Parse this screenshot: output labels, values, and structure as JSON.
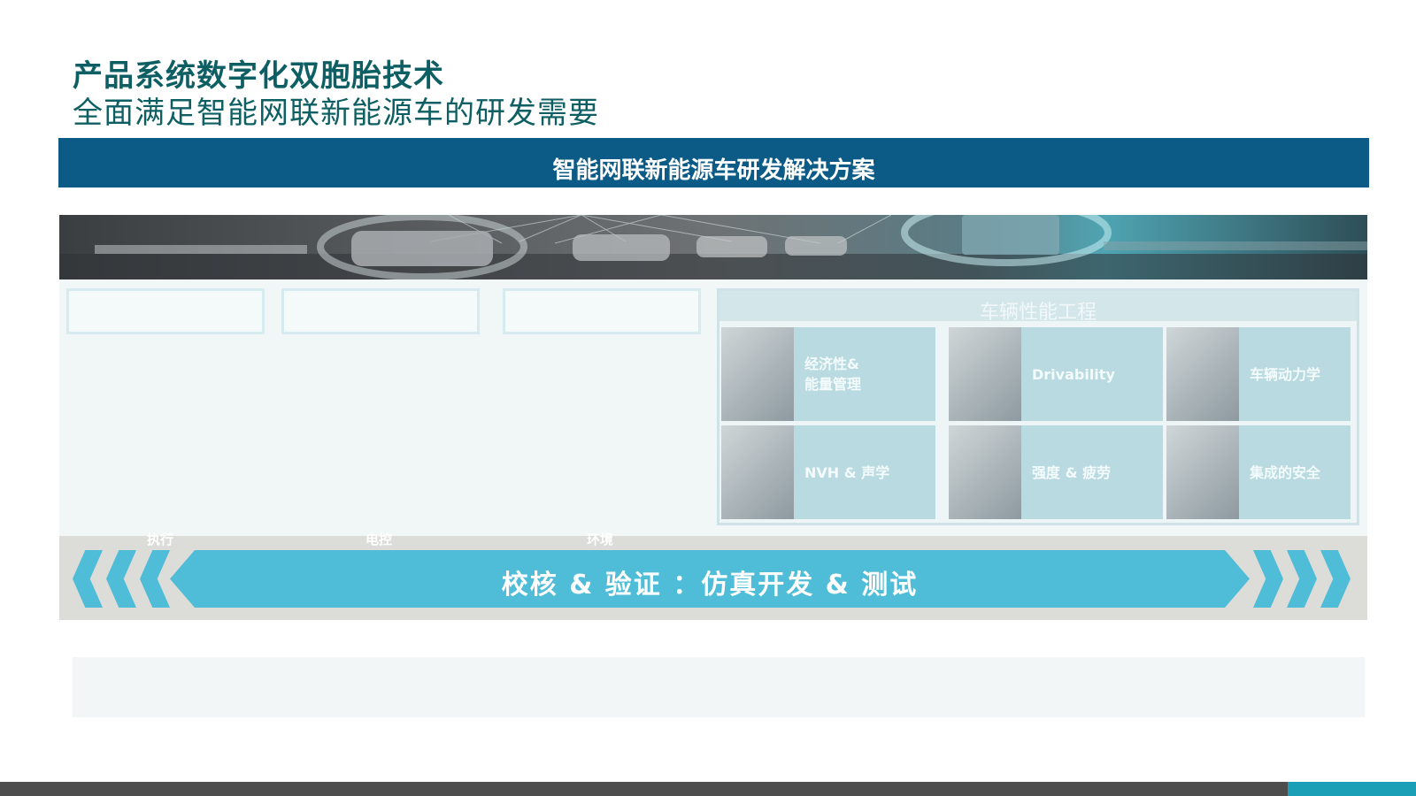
{
  "header": {
    "title_line1": "产品系统数字化双胞胎技术",
    "title_line2": "全面满足智能网联新能源车的研发需要"
  },
  "banner": {
    "label": "智能网联新能源车研发解决方案"
  },
  "left_boxes": {
    "cut_labels": [
      "执行",
      "电控",
      "环境"
    ]
  },
  "performance": {
    "heading": "车辆性能工程",
    "tiles": [
      {
        "label": "经济性&\n能量管理"
      },
      {
        "label": "Drivability"
      },
      {
        "label": "车辆动力学"
      },
      {
        "label": "NVH & 声学"
      },
      {
        "label": "强度 & 疲劳"
      },
      {
        "label": "集成的安全"
      }
    ]
  },
  "validation_bar": {
    "label": "校核 & 验证 ：仿真开发 & 测试"
  },
  "colors": {
    "title": "#0e5f63",
    "banner": "#0b5b86",
    "accent": "#4fbcd8",
    "footer_teal": "#1a9fb7"
  }
}
